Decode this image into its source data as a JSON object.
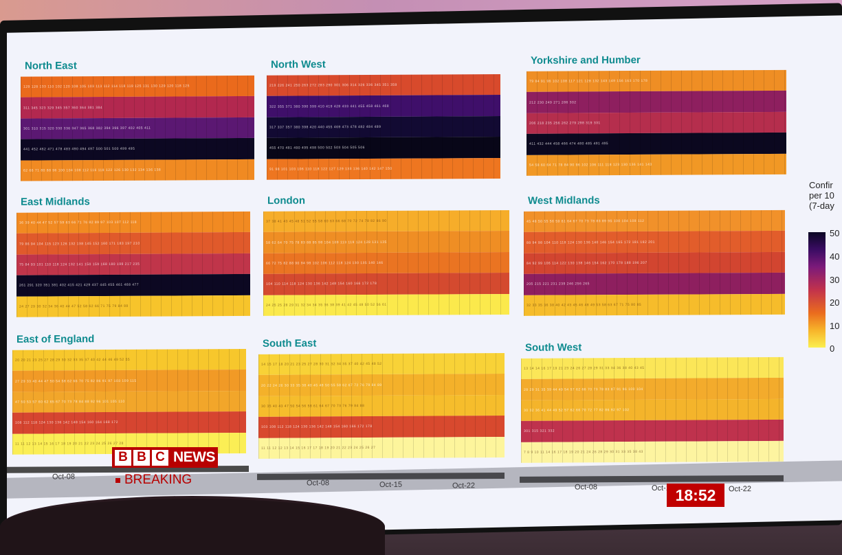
{
  "regions": [
    {
      "title": "North East",
      "rows": [
        {
          "color": "#ea6a1c",
          "text": "129 128 133 110 102 120 108 105 103 113 112 114 118 119 125 131 130 129 120 118 125"
        },
        {
          "color": "#b2284f",
          "text": "     311 345 323 329 345 357 360 364 381 384"
        },
        {
          "color": "#5b1872",
          "text": "301 310 315 320 330 336 347 365 368 382 394 396 397 402 405 411"
        },
        {
          "color": "#0c0822",
          "text": "441 452 462 471 478 483 490 494 497 500 501 500 499 495"
        },
        {
          "color": "#f08a22",
          "text": "62 66 71 80 88 96 100 104 108 112 116 118 122 126 130 132 134 136 138"
        }
      ]
    },
    {
      "title": "North West",
      "rows": [
        {
          "color": "#d84a2c",
          "text": "219 226 241 250 263 272 283 290 301 306 314 326 336 345 351 359"
        },
        {
          "color": "#3f0f6a",
          "text": "322 355 371 380 390 399 410 419 428 433 441 455 458 461 468"
        },
        {
          "color": "#120a33",
          "text": "317 337 357 380 398 420 440 455 469 473 478 482 484 489"
        },
        {
          "color": "#080618",
          "text": "455 470 481 490 495 498 500 502 503 504 505 506"
        },
        {
          "color": "#ee7620",
          "text": "91 98 101 103 106 110 118 122 127 129 133 136 140 142 147 150"
        }
      ]
    },
    {
      "title": "Yorkshire and Humber",
      "rows": [
        {
          "color": "#ef8e24",
          "text": "79 84 91 96 102 108 117 121 128 132 143 149 156 163 170 178"
        },
        {
          "color": "#8e1f5f",
          "text": "             212 230 249 271 286 302"
        },
        {
          "color": "#b52e4d",
          "text": "          206 218 235 256 262 279 298 319 331"
        },
        {
          "color": "#0b081f",
          "text": "411 432 444 458 466 474 480 485 491 495"
        },
        {
          "color": "#f19825",
          "text": "54 58 60 64 71 78 84 90 96 102 106 111 118 123 130 136 141 143"
        }
      ]
    },
    {
      "title": "East Midlands",
      "rows": [
        {
          "color": "#f18a22",
          "text": "36 39 40 44 47 52 57 59 63 66 71 76 82 89 97 103 107 112 118"
        },
        {
          "color": "#e05a2b",
          "text": "79 86 94 104 115 123 126 132 138 145 152 160 171 183 197 210"
        },
        {
          "color": "#c0354a",
          "text": "75 84 93 101 110 118 124 132 141 150 159 168 180 199 217 235"
        },
        {
          "color": "#0c0822",
          "text": "261 291 320 351 381 402 415 421 429 437 445 455 461 468 477"
        },
        {
          "color": "#f7c42b",
          "text": "24 27 29 30 32 34 36 40 44 47 52 58 62 66 71 75 79 84 88"
        }
      ]
    },
    {
      "title": "London",
      "rows": [
        {
          "color": "#f6ad2a",
          "text": "37 38 41 43 45 48 51 52 55 58 60 63 66 68 70 72 74 78 82 86 90"
        },
        {
          "color": "#ef8e24",
          "text": "58 62 64 70 75 78 83 88 95 98 104 109 113 119 124 128 131 135"
        },
        {
          "color": "#ea7422",
          "text": "66 72 75 82 88 90 94 98 102 106 112 118 124 130 135 140 146"
        },
        {
          "color": "#d44a2f",
          "text": "104 110 114 118 124 130 136 142 148 154 160 166 172 178"
        },
        {
          "color": "#fbe94c",
          "text": "24 25 25 28 29 31 32 34 34 35 36 38 39 41 42 45 48 50 52 56 61"
        }
      ]
    },
    {
      "title": "West Midlands",
      "rows": [
        {
          "color": "#f1912a",
          "text": "45 48 50 55 56 59 61 64 67 70 73 78 83 89 95 100 104 108 112"
        },
        {
          "color": "#e25d2b",
          "text": "88 94 98 104 110 118 124 130 136 140 146 154 165 172 181 192 201"
        },
        {
          "color": "#d24530",
          "text": "84 92 99 106 114 122 130 138 146 154 162 170 178 188 196 207"
        },
        {
          "color": "#8e1f5f",
          "text": "                  205 215 221 231 239 246 256 265"
        },
        {
          "color": "#f6bc2b",
          "text": "32 33 35 36 38 40 42 43 45 46 48 49 53 58 63 67 71 75 80 85"
        }
      ]
    },
    {
      "title": "East of England",
      "rows": [
        {
          "color": "#f7c72c",
          "text": "20 20 21 23 25 27 28 29 30 32 33 35 37 40 42 44 46 49 52 55"
        },
        {
          "color": "#f19a26",
          "text": "27 29 33 40 44 47 50 54 58 62 66 70 75 82 86 91 97 103 109 115"
        },
        {
          "color": "#f2a62a",
          "text": "47 50 53 57 60 62 65 67 70 73 78 84 88 92 96 101 105 110"
        },
        {
          "color": "#d64530",
          "text": "108 112 118 124 130 136 142 148 154 160 164 168 172"
        },
        {
          "color": "#fbee55",
          "text": "11 11 12 13 14 15 16 17 18 19 20 21 22 23 24 25 26 27 28"
        }
      ]
    },
    {
      "title": "South East",
      "rows": [
        {
          "color": "#f8d237",
          "text": "14 15 17 18 20 21 23 25 27 28 30 31 32 34 35 37 40 42 45 48 52"
        },
        {
          "color": "#f4b12a",
          "text": "20 22 24 26 30 33 35 38 40 45 48 50 55 58 62 67 72 76 79 84 89"
        },
        {
          "color": "#f6bd2c",
          "text": "30 35 40 43 47 50 54 56 58 61 64 67 70 73 76 79 84 88"
        },
        {
          "color": "#d8492e",
          "text": "103 108 112 118 124 130 136 142 148 154 160 166 172 178"
        },
        {
          "color": "#fdf59c",
          "text": "11 11 12 12 13 14 15 16 17 17 18 19 20 21 22 23 24 25 26 27"
        }
      ]
    },
    {
      "title": "South West",
      "rows": [
        {
          "color": "#fbe658",
          "text": "13 14 14 16 17 19 21 23 24 26 27 28 29 31 33 34 36 38 40 43 45"
        },
        {
          "color": "#f3ab2c",
          "text": "28 29 31 35 39 44 49 54 57 62 66 70 73 78 83 87 91 96 100 104"
        },
        {
          "color": "#f4b42b",
          "text": "30 32 36 41 44 49 52 57 62 66 70 72 77 82 86 92 97 102"
        },
        {
          "color": "#bf324d",
          "text": "                              301 315 321 332"
        },
        {
          "color": "#fdf4a0",
          "text": "7 8 9 10 11 14 16 17 18 19 20 21 24 26 28 29 30 31 33 35 38 43"
        }
      ]
    }
  ],
  "axes": {
    "col1": [
      "Oct-08"
    ],
    "col2": [
      "Oct-08",
      "Oct-15",
      "Oct-22"
    ],
    "col3": [
      "Oct-08",
      "Oct-15",
      "Oct-22"
    ]
  },
  "legend": {
    "title": "Confir\nper 10\n(7-day",
    "ticks": [
      "50",
      "40",
      "30",
      "20",
      "10",
      "0"
    ]
  },
  "broadcast": {
    "logo_letters": [
      "B",
      "B",
      "C"
    ],
    "logo_word": "NEWS",
    "breaking": "BREAKING",
    "clock": "18:52"
  }
}
